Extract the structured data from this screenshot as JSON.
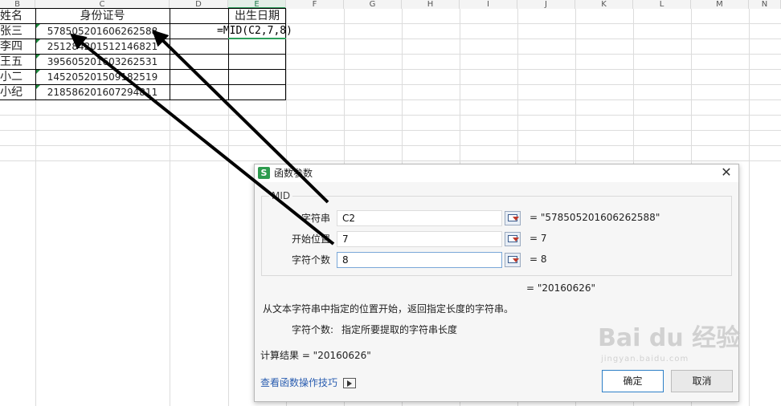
{
  "sheet": {
    "columns": [
      {
        "label": "B",
        "sel": false
      },
      {
        "label": "C",
        "sel": false
      },
      {
        "label": "D",
        "sel": false
      },
      {
        "label": "E",
        "sel": true
      },
      {
        "label": "F",
        "sel": false
      },
      {
        "label": "G",
        "sel": false
      },
      {
        "label": "H",
        "sel": false
      },
      {
        "label": "I",
        "sel": false
      },
      {
        "label": "J",
        "sel": false
      },
      {
        "label": "K",
        "sel": false
      },
      {
        "label": "L",
        "sel": false
      },
      {
        "label": "M",
        "sel": false
      },
      {
        "label": "N",
        "sel": false
      }
    ],
    "header_name": "姓名",
    "header_id": "身份证号",
    "header_birth": "出生日期",
    "rows": [
      {
        "name": "张三",
        "id": "578505201606262588"
      },
      {
        "name": "李四",
        "id": "251284201512146821"
      },
      {
        "name": "王五",
        "id": "395605201603262531"
      },
      {
        "name": "小二",
        "id": "145205201509182519"
      },
      {
        "name": "小纪",
        "id": "218586201607294811"
      }
    ],
    "formula": "=MID(C2,7,8)"
  },
  "dialog": {
    "title": "函数参数",
    "close_symbol": "✕",
    "logo": "S",
    "function_name": "MID",
    "params": [
      {
        "label": "字符串",
        "value": "C2",
        "result": "= \"578505201606262588\""
      },
      {
        "label": "开始位置",
        "value": "7",
        "result": "= 7"
      },
      {
        "label": "字符个数",
        "value": "8",
        "result": "= 8"
      }
    ],
    "overall_result": "= \"20160626\"",
    "description": "从文本字符串中指定的位置开始，返回指定长度的字符串。",
    "param_help_label": "字符个数:",
    "param_help_text": "指定所要提取的字符串长度",
    "calc_result": "计算结果 = \"20160626\"",
    "help_link": "查看函数操作技巧",
    "ok_label": "确定",
    "cancel_label": "取消"
  },
  "watermark": {
    "text": "Bai du 经验",
    "sub": "jingyan.baidu.com"
  },
  "colors": {
    "accent_green": "#2d9b4e",
    "link_blue": "#2a5db0",
    "arrow": "#000000"
  }
}
